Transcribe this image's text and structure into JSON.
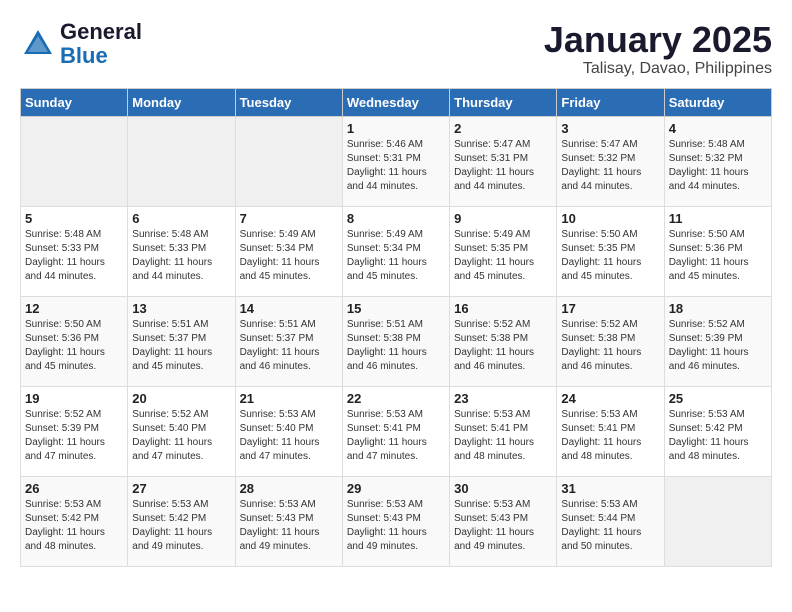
{
  "logo": {
    "line1": "General",
    "line2": "Blue"
  },
  "title": "January 2025",
  "subtitle": "Talisay, Davao, Philippines",
  "days_of_week": [
    "Sunday",
    "Monday",
    "Tuesday",
    "Wednesday",
    "Thursday",
    "Friday",
    "Saturday"
  ],
  "weeks": [
    [
      {
        "day": "",
        "info": ""
      },
      {
        "day": "",
        "info": ""
      },
      {
        "day": "",
        "info": ""
      },
      {
        "day": "1",
        "info": "Sunrise: 5:46 AM\nSunset: 5:31 PM\nDaylight: 11 hours\nand 44 minutes."
      },
      {
        "day": "2",
        "info": "Sunrise: 5:47 AM\nSunset: 5:31 PM\nDaylight: 11 hours\nand 44 minutes."
      },
      {
        "day": "3",
        "info": "Sunrise: 5:47 AM\nSunset: 5:32 PM\nDaylight: 11 hours\nand 44 minutes."
      },
      {
        "day": "4",
        "info": "Sunrise: 5:48 AM\nSunset: 5:32 PM\nDaylight: 11 hours\nand 44 minutes."
      }
    ],
    [
      {
        "day": "5",
        "info": "Sunrise: 5:48 AM\nSunset: 5:33 PM\nDaylight: 11 hours\nand 44 minutes."
      },
      {
        "day": "6",
        "info": "Sunrise: 5:48 AM\nSunset: 5:33 PM\nDaylight: 11 hours\nand 44 minutes."
      },
      {
        "day": "7",
        "info": "Sunrise: 5:49 AM\nSunset: 5:34 PM\nDaylight: 11 hours\nand 45 minutes."
      },
      {
        "day": "8",
        "info": "Sunrise: 5:49 AM\nSunset: 5:34 PM\nDaylight: 11 hours\nand 45 minutes."
      },
      {
        "day": "9",
        "info": "Sunrise: 5:49 AM\nSunset: 5:35 PM\nDaylight: 11 hours\nand 45 minutes."
      },
      {
        "day": "10",
        "info": "Sunrise: 5:50 AM\nSunset: 5:35 PM\nDaylight: 11 hours\nand 45 minutes."
      },
      {
        "day": "11",
        "info": "Sunrise: 5:50 AM\nSunset: 5:36 PM\nDaylight: 11 hours\nand 45 minutes."
      }
    ],
    [
      {
        "day": "12",
        "info": "Sunrise: 5:50 AM\nSunset: 5:36 PM\nDaylight: 11 hours\nand 45 minutes."
      },
      {
        "day": "13",
        "info": "Sunrise: 5:51 AM\nSunset: 5:37 PM\nDaylight: 11 hours\nand 45 minutes."
      },
      {
        "day": "14",
        "info": "Sunrise: 5:51 AM\nSunset: 5:37 PM\nDaylight: 11 hours\nand 46 minutes."
      },
      {
        "day": "15",
        "info": "Sunrise: 5:51 AM\nSunset: 5:38 PM\nDaylight: 11 hours\nand 46 minutes."
      },
      {
        "day": "16",
        "info": "Sunrise: 5:52 AM\nSunset: 5:38 PM\nDaylight: 11 hours\nand 46 minutes."
      },
      {
        "day": "17",
        "info": "Sunrise: 5:52 AM\nSunset: 5:38 PM\nDaylight: 11 hours\nand 46 minutes."
      },
      {
        "day": "18",
        "info": "Sunrise: 5:52 AM\nSunset: 5:39 PM\nDaylight: 11 hours\nand 46 minutes."
      }
    ],
    [
      {
        "day": "19",
        "info": "Sunrise: 5:52 AM\nSunset: 5:39 PM\nDaylight: 11 hours\nand 47 minutes."
      },
      {
        "day": "20",
        "info": "Sunrise: 5:52 AM\nSunset: 5:40 PM\nDaylight: 11 hours\nand 47 minutes."
      },
      {
        "day": "21",
        "info": "Sunrise: 5:53 AM\nSunset: 5:40 PM\nDaylight: 11 hours\nand 47 minutes."
      },
      {
        "day": "22",
        "info": "Sunrise: 5:53 AM\nSunset: 5:41 PM\nDaylight: 11 hours\nand 47 minutes."
      },
      {
        "day": "23",
        "info": "Sunrise: 5:53 AM\nSunset: 5:41 PM\nDaylight: 11 hours\nand 48 minutes."
      },
      {
        "day": "24",
        "info": "Sunrise: 5:53 AM\nSunset: 5:41 PM\nDaylight: 11 hours\nand 48 minutes."
      },
      {
        "day": "25",
        "info": "Sunrise: 5:53 AM\nSunset: 5:42 PM\nDaylight: 11 hours\nand 48 minutes."
      }
    ],
    [
      {
        "day": "26",
        "info": "Sunrise: 5:53 AM\nSunset: 5:42 PM\nDaylight: 11 hours\nand 48 minutes."
      },
      {
        "day": "27",
        "info": "Sunrise: 5:53 AM\nSunset: 5:42 PM\nDaylight: 11 hours\nand 49 minutes."
      },
      {
        "day": "28",
        "info": "Sunrise: 5:53 AM\nSunset: 5:43 PM\nDaylight: 11 hours\nand 49 minutes."
      },
      {
        "day": "29",
        "info": "Sunrise: 5:53 AM\nSunset: 5:43 PM\nDaylight: 11 hours\nand 49 minutes."
      },
      {
        "day": "30",
        "info": "Sunrise: 5:53 AM\nSunset: 5:43 PM\nDaylight: 11 hours\nand 49 minutes."
      },
      {
        "day": "31",
        "info": "Sunrise: 5:53 AM\nSunset: 5:44 PM\nDaylight: 11 hours\nand 50 minutes."
      },
      {
        "day": "",
        "info": ""
      }
    ]
  ]
}
